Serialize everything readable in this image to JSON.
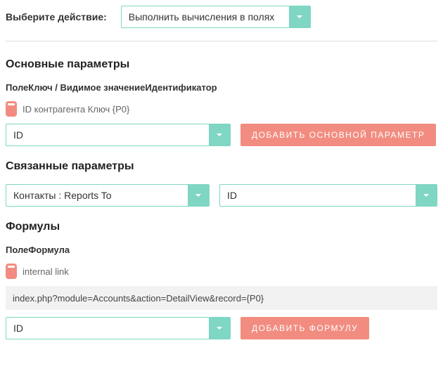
{
  "colors": {
    "accent": "#7fd6c3",
    "danger": "#f28c80"
  },
  "action": {
    "label": "Выберите действие:",
    "value": "Выполнить вычисления в полях"
  },
  "main_params": {
    "heading": "Основные параметры",
    "subhead": "ПолеКлюч / Видимое значениеИдентификатор",
    "chip_label": "ID контрагента Ключ {P0}",
    "field_value": "ID",
    "add_button": "ДОБАВИТЬ ОСНОВНОЙ ПАРАМЕТР"
  },
  "linked_params": {
    "heading": "Связанные параметры",
    "relation_value": "Контакты : Reports To",
    "field_value": "ID"
  },
  "formulas": {
    "heading": "Формулы",
    "subhead": "ПолеФормула",
    "chip_label": "internal link",
    "expression": "index.php?module=Accounts&action=DetailView&record={P0}",
    "field_value": "ID",
    "add_button": "ДОБАВИТЬ ФОРМУЛУ"
  },
  "icons": {
    "chevron_down": "chevron-down-icon",
    "delete": "delete-icon"
  }
}
